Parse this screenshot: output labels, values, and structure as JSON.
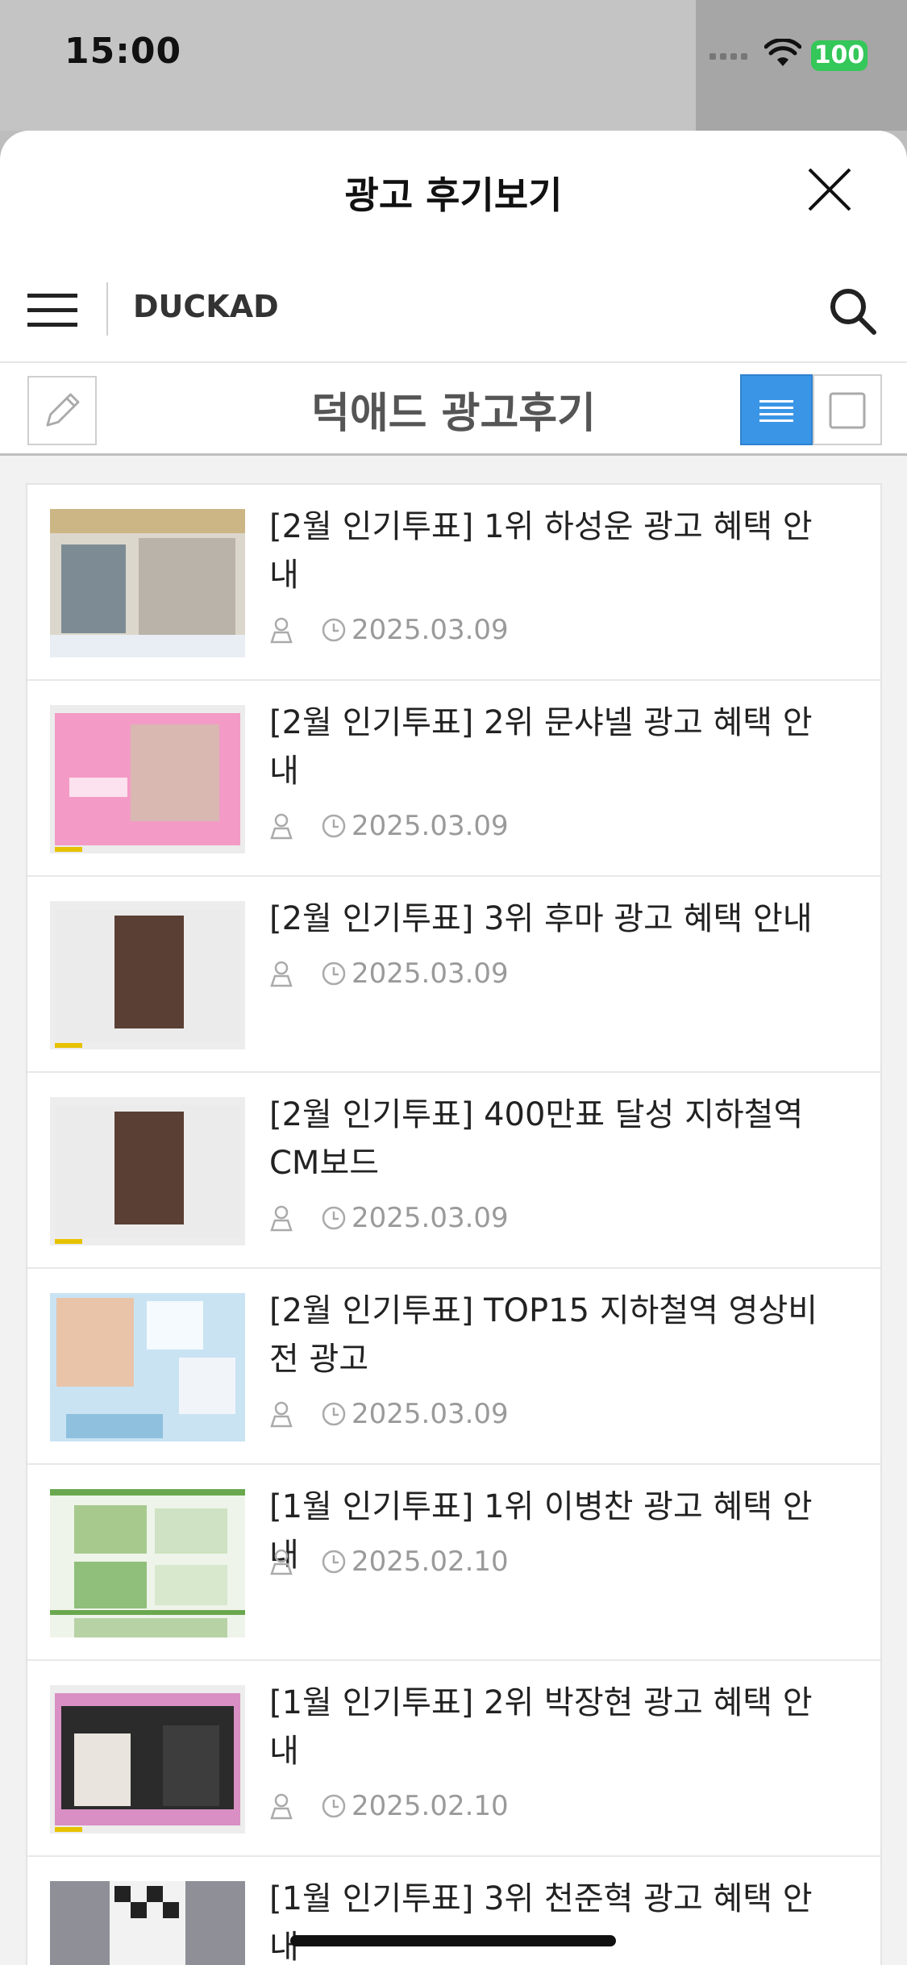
{
  "status_bar": {
    "time": "15:00",
    "battery": "100"
  },
  "sheet": {
    "title": "광고 후기보기"
  },
  "header": {
    "brand": "DUCKAD"
  },
  "board": {
    "title": "덕애드 광고후기"
  },
  "posts": [
    {
      "title": "[2월 인기투표] 1위 하성운 광고 혜택 안내",
      "date": "2025.03.09"
    },
    {
      "title": "[2월 인기투표] 2위 문샤넬 광고 혜택 안내",
      "date": "2025.03.09"
    },
    {
      "title": "[2월 인기투표] 3위 후마 광고 혜택 안내",
      "date": "2025.03.09"
    },
    {
      "title": "[2월 인기투표] 400만표 달성 지하철역 CM보드",
      "date": "2025.03.09"
    },
    {
      "title": "[2월 인기투표] TOP15 지하철역 영상비전 광고",
      "date": "2025.03.09"
    },
    {
      "title": "[1월 인기투표] 1위 이병찬 광고 혜택 안내",
      "date": "2025.02.10"
    },
    {
      "title": "[1월 인기투표] 2위 박장현 광고 혜택 안내",
      "date": "2025.02.10"
    },
    {
      "title": "[1월 인기투표] 3위 천준혁 광고 혜택 안내",
      "date": ""
    }
  ],
  "colors": {
    "accent": "#3a95e6",
    "battery": "#34c759",
    "meta": "#9a9a9a"
  }
}
